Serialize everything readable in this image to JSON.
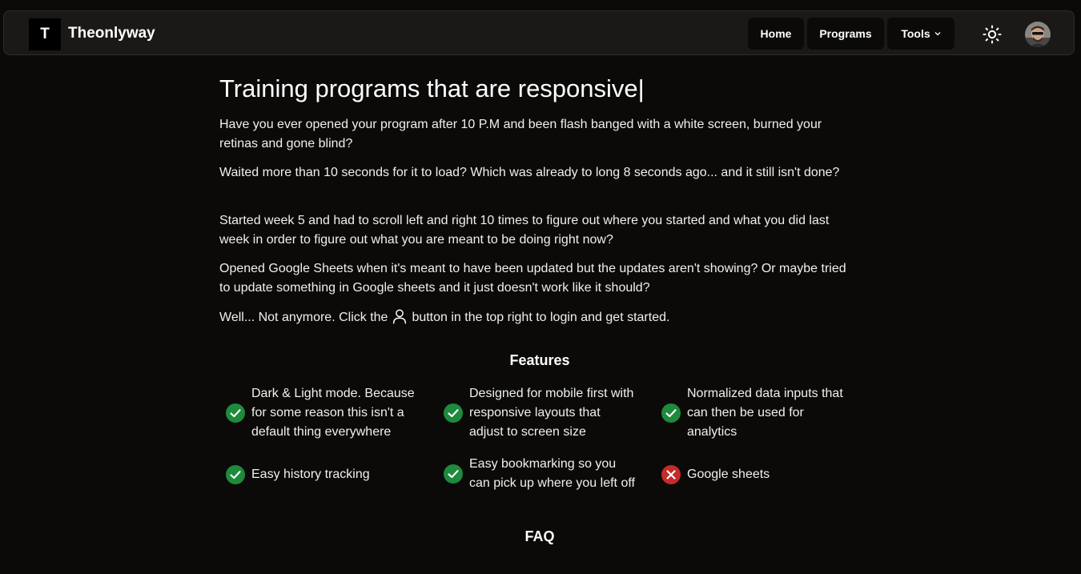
{
  "nav": {
    "logo_letter": "T",
    "brand": "Theonlyway",
    "home_label": "Home",
    "programs_label": "Programs",
    "tools_label": "Tools"
  },
  "hero": {
    "title": "Training programs that are responsive",
    "caret": "|"
  },
  "paragraphs": [
    "Have you ever opened your program after 10 P.M and been flash banged with a white screen, burned your retinas and gone blind?",
    "Waited more than 10 seconds for it to load? Which was already to long 8 seconds ago... and it still isn't done?",
    "Started week 5 and had to scroll left and right 10 times to figure out where you started and what you did last week in order to figure out what you are meant to be doing right now?",
    "Opened Google Sheets when it's meant to have been updated but the updates aren't showing? Or maybe tried to update something in Google sheets and it just doesn't work like it should?"
  ],
  "cta": {
    "before": "Well... Not anymore. Click the",
    "after": "button in the top right to login and get started.",
    "icon": "user-icon"
  },
  "features": {
    "title": "Features",
    "items": [
      {
        "text": "Dark & Light mode. Because for some reason this isn't a default thing everywhere",
        "status": "check",
        "icon": "check-circle-icon"
      },
      {
        "text": "Designed for mobile first with responsive layouts that adjust to screen size",
        "status": "check",
        "icon": "check-circle-icon"
      },
      {
        "text": "Normalized data inputs that can then be used for analytics",
        "status": "check",
        "icon": "check-circle-icon"
      },
      {
        "text": "Easy history tracking",
        "status": "check",
        "icon": "check-circle-icon"
      },
      {
        "text": "Easy bookmarking so you can pick up where you left off",
        "status": "check",
        "icon": "check-circle-icon"
      },
      {
        "text": "Google sheets",
        "status": "cross",
        "icon": "x-circle-icon"
      }
    ]
  },
  "faq": {
    "title": "FAQ"
  },
  "colors": {
    "background": "#0b0a09",
    "navbar": "#1a1918",
    "check_green": "#1e8a3c",
    "cross_red": "#c42b2b"
  }
}
